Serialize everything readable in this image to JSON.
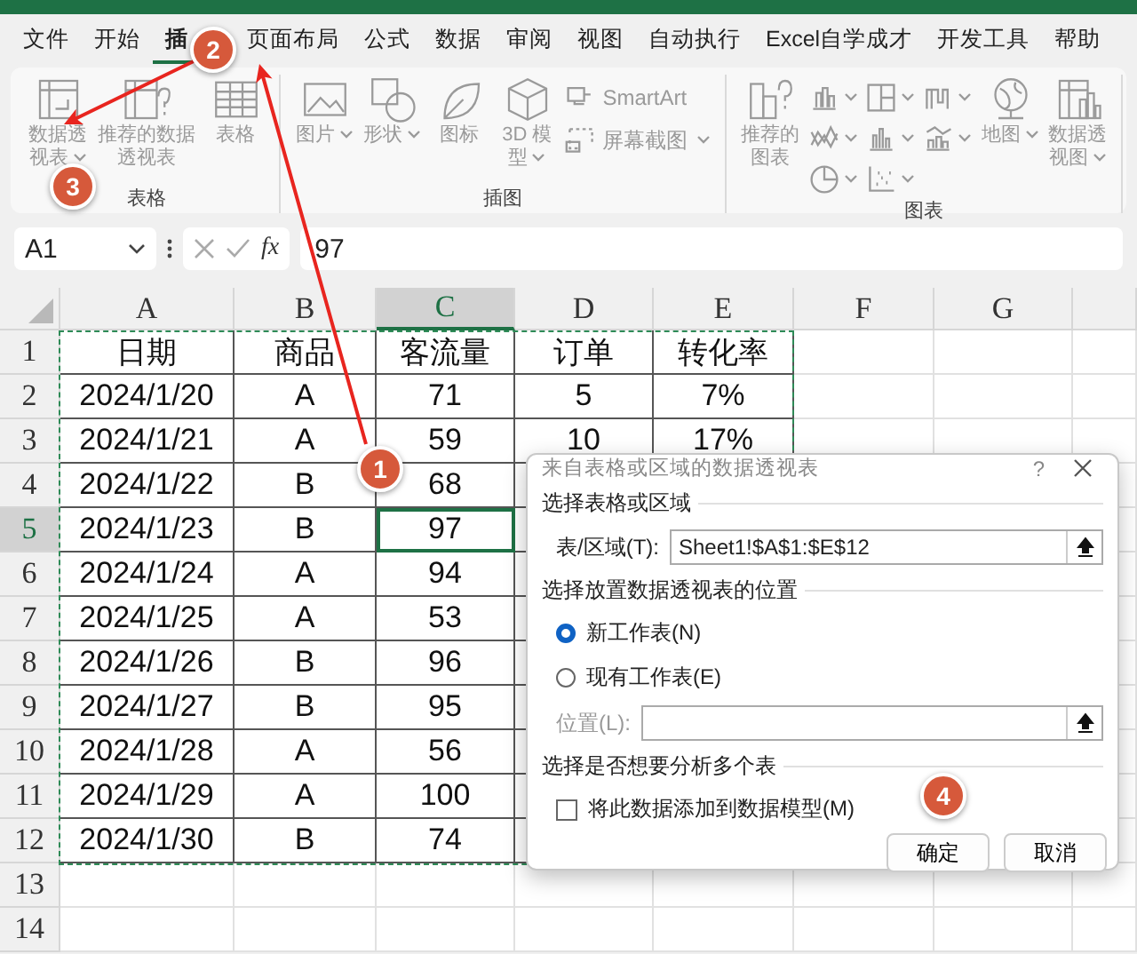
{
  "menu": [
    {
      "label": "文件",
      "selected": false
    },
    {
      "label": "开始",
      "selected": false
    },
    {
      "label": "插",
      "selected": true
    },
    {
      "label": "页面布局",
      "selected": false
    },
    {
      "label": "公式",
      "selected": false
    },
    {
      "label": "数据",
      "selected": false
    },
    {
      "label": "审阅",
      "selected": false
    },
    {
      "label": "视图",
      "selected": false
    },
    {
      "label": "自动执行",
      "selected": false
    },
    {
      "label": "Excel自学成才",
      "selected": false
    },
    {
      "label": "开发工具",
      "selected": false
    },
    {
      "label": "帮助",
      "selected": false
    }
  ],
  "ribbon": {
    "groups": [
      {
        "title": "表格",
        "items": [
          {
            "kind": "large",
            "label": "数据透视表",
            "dropdown": true,
            "disabled": true
          },
          {
            "kind": "large",
            "label": "推荐的数据透视表",
            "dropdown": false,
            "disabled": true
          },
          {
            "kind": "large",
            "label": "表格",
            "dropdown": false,
            "disabled": true
          }
        ]
      },
      {
        "title": "插图",
        "items": [
          {
            "kind": "large",
            "label": "图片",
            "dropdown": true,
            "disabled": true
          },
          {
            "kind": "large",
            "label": "形状",
            "dropdown": true,
            "disabled": true
          },
          {
            "kind": "large",
            "label": "图标",
            "dropdown": false,
            "disabled": true
          },
          {
            "kind": "large",
            "label": "3D 模型",
            "dropdown": true,
            "disabled": true
          },
          {
            "kind": "small",
            "label": "SmartArt",
            "dropdown": false,
            "disabled": true
          },
          {
            "kind": "small",
            "label": "屏幕截图",
            "dropdown": true,
            "disabled": true
          }
        ]
      },
      {
        "title": "图表",
        "items": [
          {
            "kind": "large",
            "label": "推荐的图表",
            "dropdown": false,
            "disabled": true
          },
          {
            "kind": "icon",
            "dropdown": true,
            "disabled": true
          },
          {
            "kind": "icon",
            "dropdown": true,
            "disabled": true
          },
          {
            "kind": "icon",
            "dropdown": true,
            "disabled": true
          },
          {
            "kind": "icon",
            "dropdown": true,
            "disabled": true
          },
          {
            "kind": "icon",
            "dropdown": true,
            "disabled": true
          },
          {
            "kind": "icon",
            "dropdown": true,
            "disabled": true
          },
          {
            "kind": "icon",
            "dropdown": true,
            "disabled": true
          },
          {
            "kind": "icon",
            "dropdown": true,
            "disabled": true
          },
          {
            "kind": "large",
            "label": "地图",
            "dropdown": true,
            "disabled": true
          },
          {
            "kind": "large",
            "label": "数据透视图",
            "dropdown": true,
            "disabled": true
          }
        ]
      }
    ]
  },
  "formula_bar": {
    "name_box": "A1",
    "function_label": "fx",
    "value": "97"
  },
  "columns": [
    {
      "label": "A",
      "selected": false
    },
    {
      "label": "B",
      "selected": false
    },
    {
      "label": "C",
      "selected": true
    },
    {
      "label": "D",
      "selected": false
    },
    {
      "label": "E",
      "selected": false
    },
    {
      "label": "F",
      "selected": false
    },
    {
      "label": "G",
      "selected": false
    }
  ],
  "rows": [
    {
      "number": "1",
      "selected": false,
      "cells": [
        "日期",
        "商品",
        "客流量",
        "订单",
        "转化率"
      ]
    },
    {
      "number": "2",
      "selected": false,
      "cells": [
        "2024/1/20",
        "A",
        "71",
        "5",
        "7%"
      ]
    },
    {
      "number": "3",
      "selected": false,
      "cells": [
        "2024/1/21",
        "A",
        "59",
        "10",
        "17%"
      ]
    },
    {
      "number": "4",
      "selected": false,
      "cells": [
        "2024/1/22",
        "B",
        "68"
      ]
    },
    {
      "number": "5",
      "selected": true,
      "cells": [
        "2024/1/23",
        "B",
        "97"
      ]
    },
    {
      "number": "6",
      "selected": false,
      "cells": [
        "2024/1/24",
        "A",
        "94"
      ]
    },
    {
      "number": "7",
      "selected": false,
      "cells": [
        "2024/1/25",
        "A",
        "53"
      ]
    },
    {
      "number": "8",
      "selected": false,
      "cells": [
        "2024/1/26",
        "B",
        "96"
      ]
    },
    {
      "number": "9",
      "selected": false,
      "cells": [
        "2024/1/27",
        "B",
        "95"
      ]
    },
    {
      "number": "10",
      "selected": false,
      "cells": [
        "2024/1/28",
        "A",
        "56"
      ]
    },
    {
      "number": "11",
      "selected": false,
      "cells": [
        "2024/1/29",
        "A",
        "100"
      ]
    },
    {
      "number": "12",
      "selected": false,
      "cells": [
        "2024/1/30",
        "B",
        "74"
      ]
    },
    {
      "number": "13",
      "selected": false
    },
    {
      "number": "14",
      "selected": false
    }
  ],
  "dialog": {
    "title": "来自表格或区域的数据透视表",
    "help": "?",
    "sections": [
      {
        "heading": "选择表格或区域",
        "controls": [
          {
            "kind": "field",
            "label": "表/区域(T):",
            "value": "Sheet1!$A$1:$E$12",
            "disabled": false
          }
        ]
      },
      {
        "heading": "选择放置数据透视表的位置",
        "controls": [
          {
            "kind": "radio",
            "label": "新工作表(N)",
            "selected": true
          },
          {
            "kind": "radio",
            "label": "现有工作表(E)",
            "selected": false
          },
          {
            "kind": "field",
            "label": "位置(L):",
            "disabled": true
          }
        ]
      },
      {
        "heading": "选择是否想要分析多个表",
        "controls": [
          {
            "kind": "checkbox",
            "label": "将此数据添加到数据模型(M)",
            "checked": false
          }
        ]
      }
    ],
    "buttons": [
      "确定",
      "取消"
    ]
  },
  "callouts": [
    "1",
    "2",
    "3",
    "4"
  ]
}
